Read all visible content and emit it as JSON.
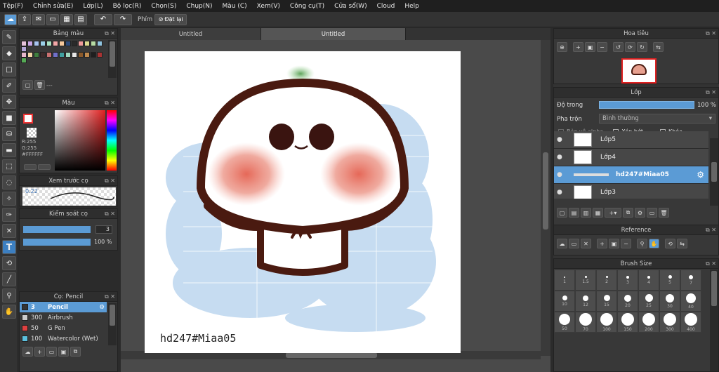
{
  "menu": [
    "Tệp(F)",
    "Chỉnh sửa(E)",
    "Lớp(L)",
    "Bộ lọc(R)",
    "Chọn(S)",
    "Chụp(N)",
    "Màu (C)",
    "Xem(V)",
    "Công cụ(T)",
    "Cửa sổ(W)",
    "Cloud",
    "Help"
  ],
  "toolbar": {
    "key_label": "Phím",
    "reset_label": "Đặt lại"
  },
  "tabs": [
    "Untitled",
    "Untitled"
  ],
  "palette": {
    "title": "Bảng màu",
    "footer": "---",
    "colors": [
      "#e7c4dc",
      "#c9a7e8",
      "#a8c4ef",
      "#9cd0e8",
      "#a9e3c3",
      "#f2a7a7",
      "#f6c89c",
      "#2d4a7a",
      "#2a2a2a",
      "#ee9b9b",
      "#d9d98e",
      "#b6dba3",
      "#8fc4e0",
      "#b3a6d9",
      "#e8b8cc",
      "#f5d7a8",
      "#3f7f3f",
      "#3d2b2b",
      "#c97070",
      "#7070c9",
      "#3fa0a0",
      "#9fd9bf",
      "#e6e6e6",
      "#8b5a2b",
      "#c08a4e",
      "#1f1f1f",
      "#aa3333",
      "#55aa55"
    ]
  },
  "color": {
    "title": "Màu",
    "r": "R:255",
    "g": "G:255",
    "hex": "#FFFFFF"
  },
  "preview": {
    "title": "Xem trước cọ",
    "value": "0.22"
  },
  "brush_control": {
    "title": "Kiểm soát cọ",
    "size": "3",
    "opacity": "100 %",
    "size_fill": 1.0,
    "opacity_fill": 1.0
  },
  "brushes": {
    "title": "Cọ: Pencil",
    "items": [
      {
        "size": "3",
        "name": "Pencil",
        "color": "#333333"
      },
      {
        "size": "300",
        "name": "Airbrush",
        "color": "#cccccc"
      },
      {
        "size": "50",
        "name": "G Pen",
        "color": "#e04040"
      },
      {
        "size": "100",
        "name": "Watercolor (Wet)",
        "color": "#5bc0de"
      }
    ]
  },
  "navigator": {
    "title": "Hoa tiêu"
  },
  "layer": {
    "title": "Lớp",
    "opacity_label": "Độ trong",
    "opacity_value": "100 %",
    "blend_label": "Pha trộn",
    "blend_value": "Bình thường",
    "protect_alpha": "Bảo vệ alpha",
    "clip": "Xén bớt",
    "lock": "Khóa",
    "items": [
      {
        "name": "Lớp5"
      },
      {
        "name": "Lớp4"
      },
      {
        "name": "hd247#Miaa05"
      },
      {
        "name": "Lớp3"
      }
    ]
  },
  "reference": {
    "title": "Reference"
  },
  "brush_size": {
    "title": "Brush Size",
    "sizes": [
      "1",
      "1.5",
      "2",
      "3",
      "4",
      "5",
      "7",
      "10",
      "12",
      "15",
      "20",
      "25",
      "30",
      "40",
      "50",
      "70",
      "100",
      "150",
      "200",
      "300",
      "400"
    ]
  },
  "canvas": {
    "watermark": "hd247#Miaa05"
  }
}
